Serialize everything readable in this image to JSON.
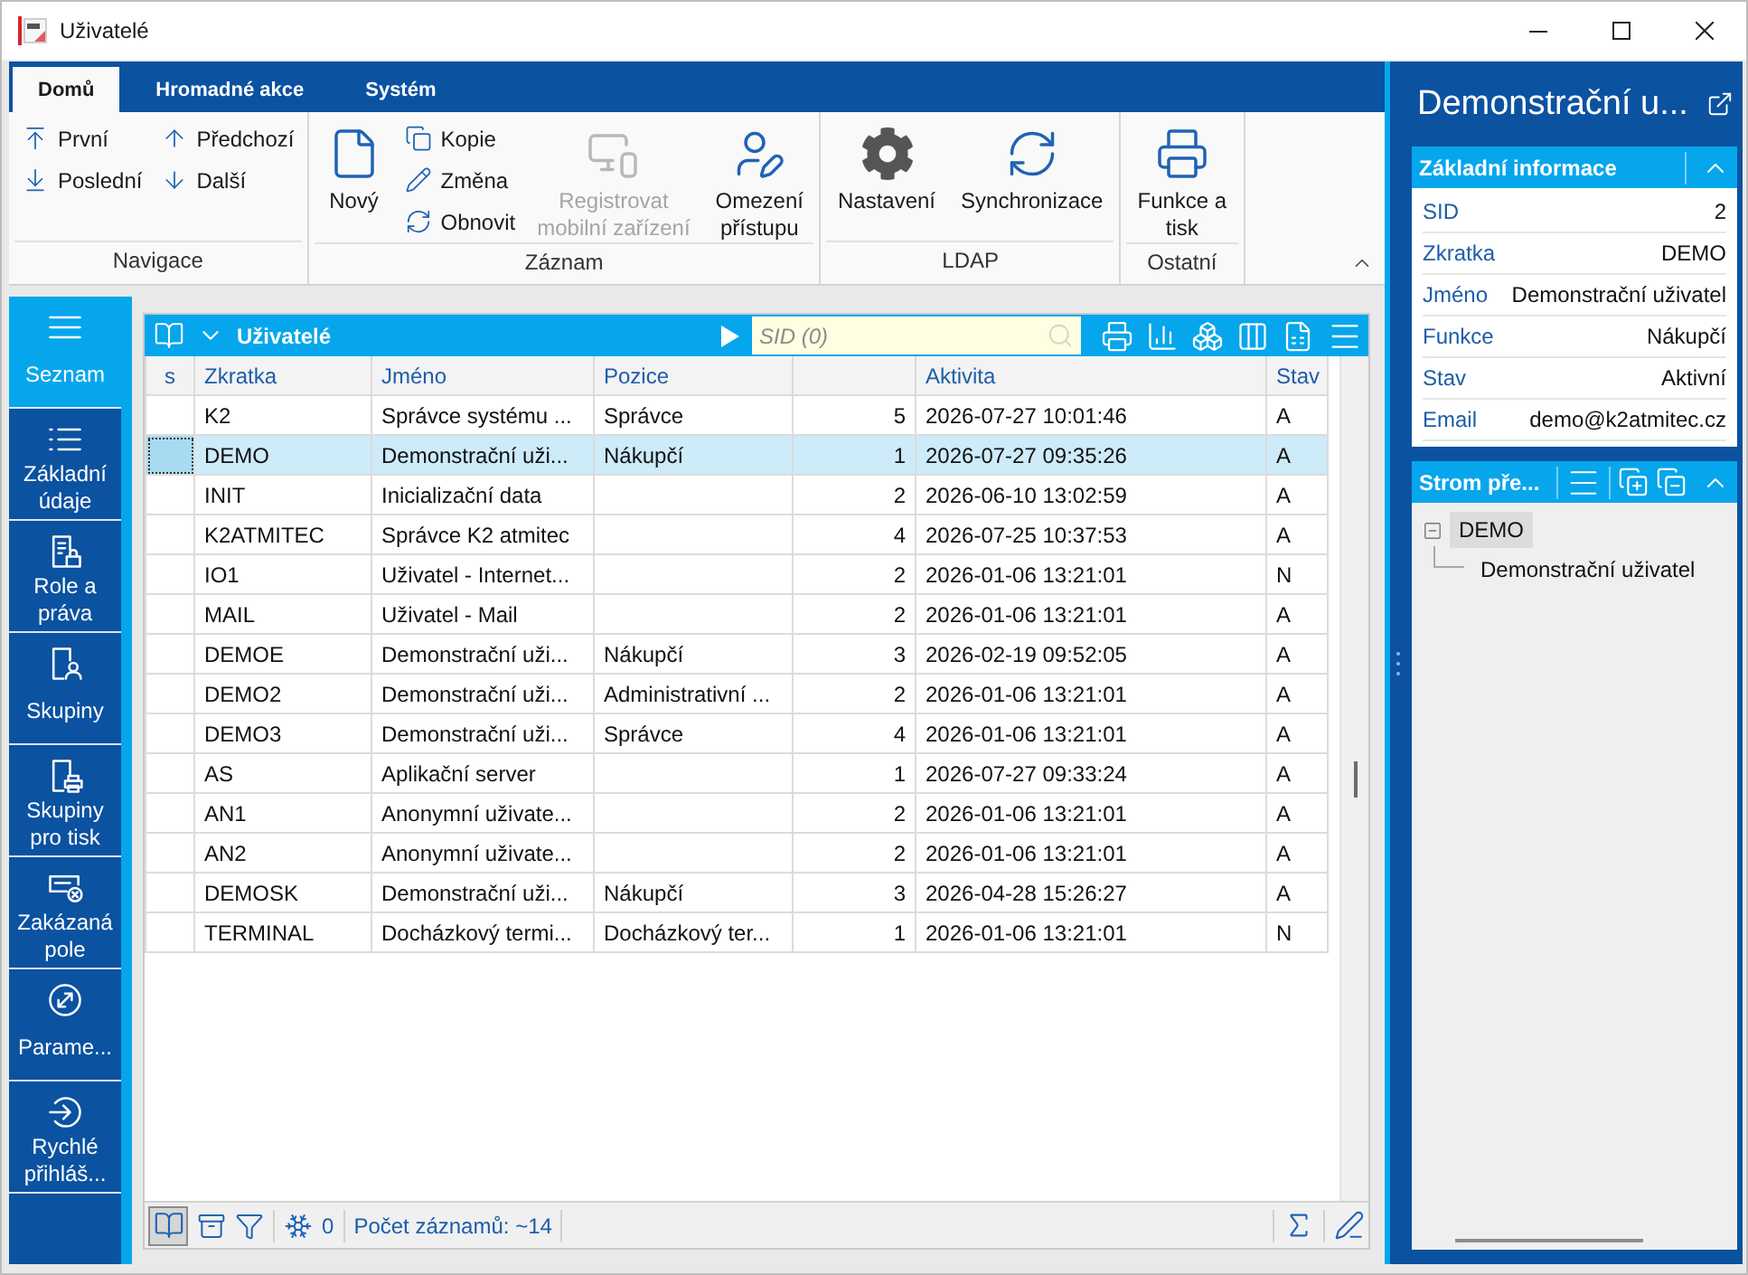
{
  "window": {
    "title": "Uživatelé"
  },
  "ribbon": {
    "tabs": [
      {
        "label": "Domů",
        "selected": true
      },
      {
        "label": "Hromadné akce",
        "selected": false
      },
      {
        "label": "Systém",
        "selected": false
      }
    ],
    "groups": [
      {
        "label": "Navigace",
        "items": [
          {
            "kind": "stack",
            "items": [
              {
                "label": "První",
                "disabled": false
              },
              {
                "label": "Poslední",
                "disabled": false
              }
            ]
          },
          {
            "kind": "stack",
            "items": [
              {
                "label": "Předchozí",
                "disabled": false
              },
              {
                "label": "Další",
                "disabled": false
              }
            ]
          }
        ]
      },
      {
        "label": "Záznam",
        "items": [
          {
            "kind": "large",
            "label": "Nový",
            "disabled": false
          },
          {
            "kind": "stack",
            "items": [
              {
                "label": "Kopie",
                "disabled": false
              },
              {
                "label": "Změna",
                "disabled": false
              },
              {
                "label": "Obnovit",
                "disabled": false
              }
            ]
          },
          {
            "kind": "large",
            "label": "Registrovat\nmobilní zařízení",
            "disabled": true
          },
          {
            "kind": "large",
            "label": "Omezení\npřístupu",
            "disabled": false
          }
        ]
      },
      {
        "label": "LDAP",
        "items": [
          {
            "kind": "large",
            "label": "Nastavení",
            "disabled": false
          },
          {
            "kind": "large",
            "label": "Synchronizace",
            "disabled": false
          }
        ]
      },
      {
        "label": "Ostatní",
        "items": [
          {
            "kind": "large",
            "label": "Funkce a\ntisk",
            "disabled": false
          }
        ]
      }
    ]
  },
  "navigation": {
    "items": [
      {
        "label": "Seznam",
        "selected": true
      },
      {
        "label": "Základní\núdaje",
        "selected": false
      },
      {
        "label": "Role a\npráva",
        "selected": false
      },
      {
        "label": "Skupiny",
        "selected": false
      },
      {
        "label": "Skupiny\npro tisk",
        "selected": false
      },
      {
        "label": "Zakázaná\npole",
        "selected": false
      },
      {
        "label": "Parame...",
        "selected": false
      },
      {
        "label": "Rychlé\npřihláš...",
        "selected": false
      }
    ]
  },
  "table": {
    "title": "Uživatelé",
    "search": {
      "placeholder": "SID (0)"
    },
    "columns": [
      {
        "label": "s",
        "kind": "marker"
      },
      {
        "label": "Zkratka",
        "kind": "text"
      },
      {
        "label": "Jméno",
        "kind": "text"
      },
      {
        "label": "Pozice",
        "kind": "text"
      },
      {
        "kind": "number"
      },
      {
        "label": "Aktivita",
        "kind": "text"
      },
      {
        "label": "Stav",
        "kind": "text"
      }
    ],
    "rows": [
      {
        "zkratka": "K2",
        "jmeno": "Správce systému ...",
        "pozice": "Správce",
        "column_5": "5",
        "aktivita": "2026-07-27 10:01:46",
        "stav": "A",
        "selected": false
      },
      {
        "zkratka": "DEMO",
        "jmeno": "Demonstrační uži...",
        "pozice": "Nákupčí",
        "column_5": "1",
        "aktivita": "2026-07-27 09:35:26",
        "stav": "A",
        "selected": true
      },
      {
        "zkratka": "INIT",
        "jmeno": "Inicializační data",
        "column_5": "2",
        "aktivita": "2026-06-10 13:02:59",
        "stav": "A",
        "selected": false
      },
      {
        "zkratka": "K2ATMITEC",
        "jmeno": "Správce K2 atmitec",
        "column_5": "4",
        "aktivita": "2026-07-25 10:37:53",
        "stav": "A",
        "selected": false
      },
      {
        "zkratka": "IO1",
        "jmeno": "Uživatel - Internet...",
        "column_5": "2",
        "aktivita": "2026-01-06 13:21:01",
        "stav": "N",
        "selected": false
      },
      {
        "zkratka": "MAIL",
        "jmeno": "Uživatel - Mail",
        "column_5": "2",
        "aktivita": "2026-01-06 13:21:01",
        "stav": "A",
        "selected": false
      },
      {
        "zkratka": "DEMOE",
        "jmeno": "Demonstrační uži...",
        "pozice": "Nákupčí",
        "column_5": "3",
        "aktivita": "2026-02-19 09:52:05",
        "stav": "A",
        "selected": false
      },
      {
        "zkratka": "DEMO2",
        "jmeno": "Demonstrační uži...",
        "pozice": "Administrativní ...",
        "column_5": "2",
        "aktivita": "2026-01-06 13:21:01",
        "stav": "A",
        "selected": false
      },
      {
        "zkratka": "DEMO3",
        "jmeno": "Demonstrační uži...",
        "pozice": "Správce",
        "column_5": "4",
        "aktivita": "2026-01-06 13:21:01",
        "stav": "A",
        "selected": false
      },
      {
        "zkratka": "AS",
        "jmeno": "Aplikační server",
        "column_5": "1",
        "aktivita": "2026-07-27 09:33:24",
        "stav": "A",
        "selected": false
      },
      {
        "zkratka": "AN1",
        "jmeno": "Anonymní uživate...",
        "column_5": "2",
        "aktivita": "2026-01-06 13:21:01",
        "stav": "A",
        "selected": false
      },
      {
        "zkratka": "AN2",
        "jmeno": "Anonymní uživate...",
        "column_5": "2",
        "aktivita": "2026-01-06 13:21:01",
        "stav": "A",
        "selected": false
      },
      {
        "zkratka": "DEMOSK",
        "jmeno": "Demonstrační uži...",
        "pozice": "Nákupčí",
        "column_5": "3",
        "aktivita": "2026-04-28 15:26:27",
        "stav": "A",
        "selected": false
      },
      {
        "zkratka": "TERMINAL",
        "jmeno": "Docházkový termi...",
        "pozice": "Docházkový ter...",
        "column_5": "1",
        "aktivita": "2026-01-06 13:21:01",
        "stav": "N",
        "selected": false
      }
    ]
  },
  "status_bar": {
    "list_view_on": true,
    "selection_count": "0",
    "record_count": "Počet záznamů: ~14"
  },
  "detail_panel": {
    "title": "Demonstrační u...",
    "sections": [
      {
        "kind": "fields",
        "title": "Základní informace",
        "expanded": true,
        "fields": [
          {
            "label": "SID",
            "value": "2"
          },
          {
            "label": "Zkratka",
            "value": "DEMO"
          },
          {
            "label": "Jméno",
            "value": "Demonstrační uživatel"
          },
          {
            "label": "Funkce",
            "value": "Nákupčí"
          },
          {
            "label": "Stav",
            "value": "Aktivní"
          },
          {
            "label": "Email",
            "value": "demo@k2atmitec.cz"
          }
        ]
      },
      {
        "kind": "tree",
        "title": "Strom pře...",
        "expanded": true,
        "nodes": [
          {
            "label": "DEMO",
            "selected": true,
            "expanded": true,
            "children": [
              {
                "label": "Demonstrační uživatel",
                "selected": false
              }
            ]
          }
        ]
      }
    ]
  }
}
